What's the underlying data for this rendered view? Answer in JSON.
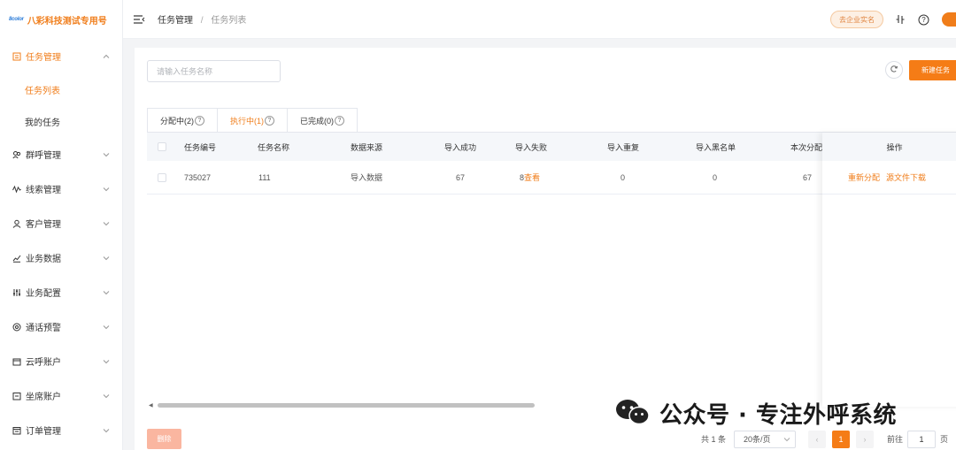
{
  "brand": {
    "logo_text": "8color",
    "name": "八彩科技测试专用号"
  },
  "sidebar": {
    "items": [
      {
        "label": "任务管理",
        "icon": "list-icon",
        "expanded": true,
        "active": true,
        "children": [
          {
            "label": "任务列表",
            "active": true
          },
          {
            "label": "我的任务",
            "active": false
          }
        ]
      },
      {
        "label": "群呼管理",
        "icon": "users-icon"
      },
      {
        "label": "线索管理",
        "icon": "wave-icon"
      },
      {
        "label": "客户管理",
        "icon": "person-icon"
      },
      {
        "label": "业务数据",
        "icon": "chart-icon"
      },
      {
        "label": "业务配置",
        "icon": "sliders-icon"
      },
      {
        "label": "通话预警",
        "icon": "alert-icon"
      },
      {
        "label": "云呼账户",
        "icon": "wallet-icon"
      },
      {
        "label": "坐席账户",
        "icon": "seat-icon"
      },
      {
        "label": "订单管理",
        "icon": "order-icon"
      }
    ]
  },
  "header": {
    "breadcrumb_parent": "任务管理",
    "breadcrumb_separator": "/",
    "breadcrumb_current": "任务列表",
    "verify_button": "去企业实名"
  },
  "toolbar": {
    "search_placeholder": "请输入任务名称",
    "new_task_label": "新建任务"
  },
  "tabs": [
    {
      "label": "分配中(2)",
      "active": false
    },
    {
      "label": "执行中(1)",
      "active": true
    },
    {
      "label": "已完成(0)",
      "active": false
    }
  ],
  "tab_help": "?",
  "table": {
    "columns": [
      "任务编号",
      "任务名称",
      "数据来源",
      "导入成功",
      "导入失败",
      "导入重复",
      "导入黑名单",
      "本次分配",
      "操作"
    ],
    "rows": [
      {
        "id": "735027",
        "name": "111",
        "source": "导入数据",
        "success": "67",
        "fail_count": "8",
        "fail_link": "查看",
        "duplicate": "0",
        "blacklist": "0",
        "assigned": "67",
        "actions": [
          "重新分配",
          "源文件下载"
        ]
      }
    ]
  },
  "footer": {
    "delete_label": "删除",
    "total_text": "共 1 条",
    "page_size": "20条/页",
    "prev": "‹",
    "next": "›",
    "current_page": "1",
    "goto_label": "前往",
    "goto_value": "1",
    "page_suffix": "页"
  },
  "watermark": {
    "text": "公众号 · 专注外呼系统"
  },
  "colors": {
    "accent": "#f57c16",
    "accent_text": "#f07d1a",
    "link_blue": "#2a7bd8"
  }
}
